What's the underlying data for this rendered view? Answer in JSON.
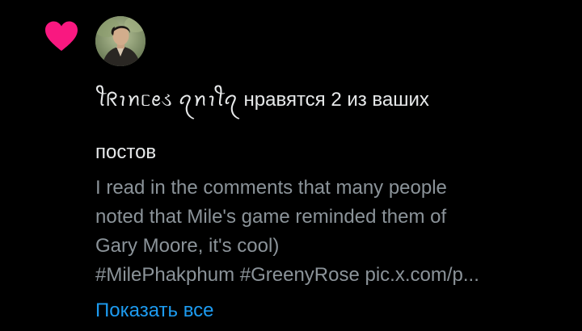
{
  "notification": {
    "type_icon": "heart-icon",
    "accent_color": "#f91880",
    "link_color": "#1d9bf0",
    "secondary_text_color": "#8b9399",
    "user_display_name": "ꪻᖇꪱꪀᥴꫀડ ꪖꪀꪱꪻꪖ",
    "action_text": " нравятся 2 из ваших",
    "action_text_continued": "постов",
    "post_lines": [
      "I read in the comments that many people",
      "noted that Mile's game reminded them of",
      "Gary Moore, it's cool)",
      "#MilePhakphum #GreenyRose pic.x.com/p..."
    ],
    "show_all_label": "Показать все"
  }
}
